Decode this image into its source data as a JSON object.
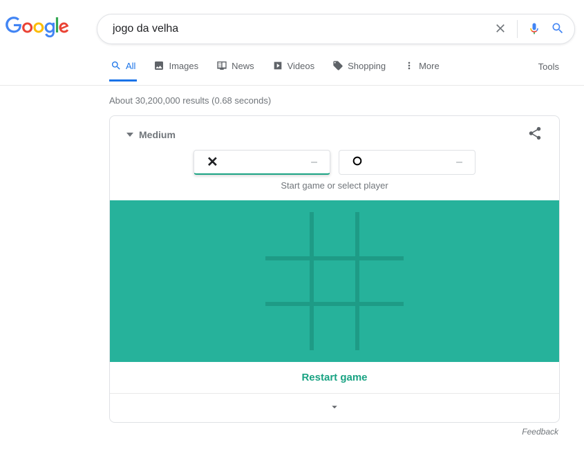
{
  "search": {
    "query": "jogo da velha"
  },
  "tabs": {
    "all": "All",
    "images": "Images",
    "news": "News",
    "videos": "Videos",
    "shopping": "Shopping",
    "more": "More",
    "tools": "Tools"
  },
  "stats": "About 30,200,000 results (0.68 seconds)",
  "game": {
    "difficulty": "Medium",
    "x_score": "–",
    "o_score": "–",
    "hint": "Start game or select player",
    "restart": "Restart game"
  },
  "footer": {
    "feedback": "Feedback"
  }
}
